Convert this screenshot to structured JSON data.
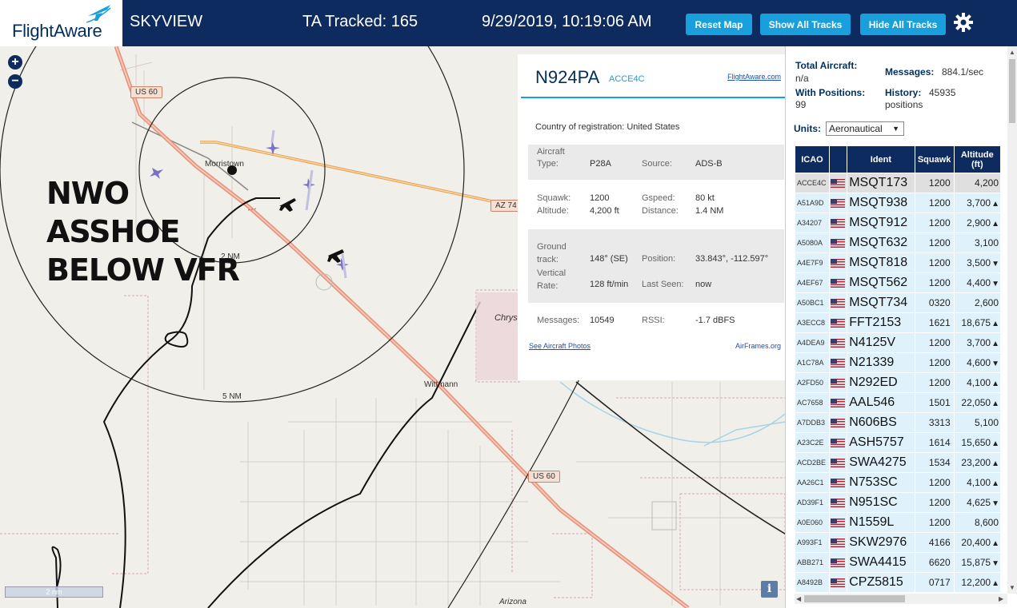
{
  "header": {
    "logo_text": "FlightAware",
    "app_title": "SKYVIEW",
    "tracked": "TA Tracked: 165",
    "datetime": "9/29/2019, 10:19:06 AM",
    "reset_label": "Reset Map",
    "show_tracks_label": "Show All Tracks",
    "hide_tracks_label": "Hide All Tracks",
    "settings_icon": "gear-icon",
    "accent_color": "#19a0dc",
    "bar_color": "#0d2b5e"
  },
  "map": {
    "annotation": [
      "NWO",
      "ASSHOE",
      "BELOW VFR"
    ],
    "road_us60_a": "US 60",
    "road_us60_b": "US 60",
    "road_az74": "AZ 74",
    "town_morristown": "Morristown",
    "town_wittmann": "Wittmann",
    "range_2nm": "2 NM",
    "range_5nm": "5 NM",
    "place_chrys": "Chrys",
    "place_arizona": "Arizona",
    "scale_label": "2 nm",
    "zoom_in": "+",
    "zoom_out": "−",
    "info": "i"
  },
  "popup": {
    "registration": "N924PA",
    "hex": "ACCE4C",
    "fa_link": "FlightAware.com",
    "country_label": "Country of registration:",
    "country_value": "United States",
    "aircraft_type_label": "Aircraft Type:",
    "aircraft_type": "P28A",
    "source_label": "Source:",
    "source": "ADS-B",
    "squawk_label": "Squawk:",
    "squawk": "1200",
    "altitude_label": "Altitude:",
    "altitude": "4,200 ft",
    "gspeed_label": "Gspeed:",
    "gspeed": "80 kt",
    "distance_label": "Distance:",
    "distance": "1.4 NM",
    "ground_track_label": "Ground track:",
    "ground_track": "148° (SE)",
    "position_label": "Position:",
    "position": "33.843°, -112.597°",
    "vertical_rate_label": "Vertical Rate:",
    "vertical_rate": "128 ft/min",
    "last_seen_label": "Last Seen:",
    "last_seen": "now",
    "messages_label": "Messages:",
    "messages": "10549",
    "rssi_label": "RSSI:",
    "rssi": "-1.7 dBFS",
    "photos_link": "See Aircraft Photos",
    "airframes_link": "AirFrames.org"
  },
  "stats": {
    "total_label": "Total Aircraft:",
    "total_value": "n/a",
    "messages_label": "Messages:",
    "messages_value": "884.1/sec",
    "positions_label": "With Positions:",
    "positions_value": "99",
    "history_label": "History:",
    "history_value": "45935 positions",
    "units_label": "Units:",
    "units_value": "Aeronautical"
  },
  "table": {
    "columns": [
      "ICAO",
      "",
      "Ident",
      "Squawk",
      "Altitude (ft)"
    ],
    "rows": [
      {
        "icao": "ACCE4C",
        "ident": "MSQT173",
        "squawk": "1200",
        "alt": "4,200",
        "trend": ""
      },
      {
        "icao": "A51A9D",
        "ident": "MSQT938",
        "squawk": "1200",
        "alt": "3,700",
        "trend": "▲"
      },
      {
        "icao": "A34207",
        "ident": "MSQT912",
        "squawk": "1200",
        "alt": "2,900",
        "trend": "▲"
      },
      {
        "icao": "A5080A",
        "ident": "MSQT632",
        "squawk": "1200",
        "alt": "3,100",
        "trend": ""
      },
      {
        "icao": "A4E7F9",
        "ident": "MSQT818",
        "squawk": "1200",
        "alt": "3,500",
        "trend": "▼"
      },
      {
        "icao": "A4EF67",
        "ident": "MSQT562",
        "squawk": "1200",
        "alt": "4,400",
        "trend": "▼"
      },
      {
        "icao": "A50BC1",
        "ident": "MSQT734",
        "squawk": "0320",
        "alt": "2,600",
        "trend": ""
      },
      {
        "icao": "A3ECC8",
        "ident": "FFT2153",
        "squawk": "1621",
        "alt": "18,675",
        "trend": "▲"
      },
      {
        "icao": "A4DEA9",
        "ident": "N4125V",
        "squawk": "1200",
        "alt": "3,700",
        "trend": "▲"
      },
      {
        "icao": "A1C78A",
        "ident": "N21339",
        "squawk": "1200",
        "alt": "4,600",
        "trend": "▼"
      },
      {
        "icao": "A2FD50",
        "ident": "N292ED",
        "squawk": "1200",
        "alt": "4,100",
        "trend": "▲"
      },
      {
        "icao": "AC7658",
        "ident": "AAL546",
        "squawk": "1501",
        "alt": "22,050",
        "trend": "▲"
      },
      {
        "icao": "A7DDB3",
        "ident": "N606BS",
        "squawk": "3313",
        "alt": "5,100",
        "trend": ""
      },
      {
        "icao": "A23C2E",
        "ident": "ASH5757",
        "squawk": "1614",
        "alt": "15,650",
        "trend": "▲"
      },
      {
        "icao": "ACD2BE",
        "ident": "SWA4275",
        "squawk": "1534",
        "alt": "23,200",
        "trend": "▲"
      },
      {
        "icao": "AA26C1",
        "ident": "N753SC",
        "squawk": "1200",
        "alt": "4,100",
        "trend": "▲"
      },
      {
        "icao": "AD39F1",
        "ident": "N951SC",
        "squawk": "1200",
        "alt": "4,625",
        "trend": "▼"
      },
      {
        "icao": "A0E060",
        "ident": "N1559L",
        "squawk": "1200",
        "alt": "8,600",
        "trend": ""
      },
      {
        "icao": "A993F1",
        "ident": "SKW2976",
        "squawk": "4166",
        "alt": "20,400",
        "trend": "▲"
      },
      {
        "icao": "ABB271",
        "ident": "SWA4415",
        "squawk": "6620",
        "alt": "15,875",
        "trend": "▼"
      },
      {
        "icao": "A8492B",
        "ident": "CPZ5815",
        "squawk": "0717",
        "alt": "12,200",
        "trend": "▲"
      }
    ]
  }
}
